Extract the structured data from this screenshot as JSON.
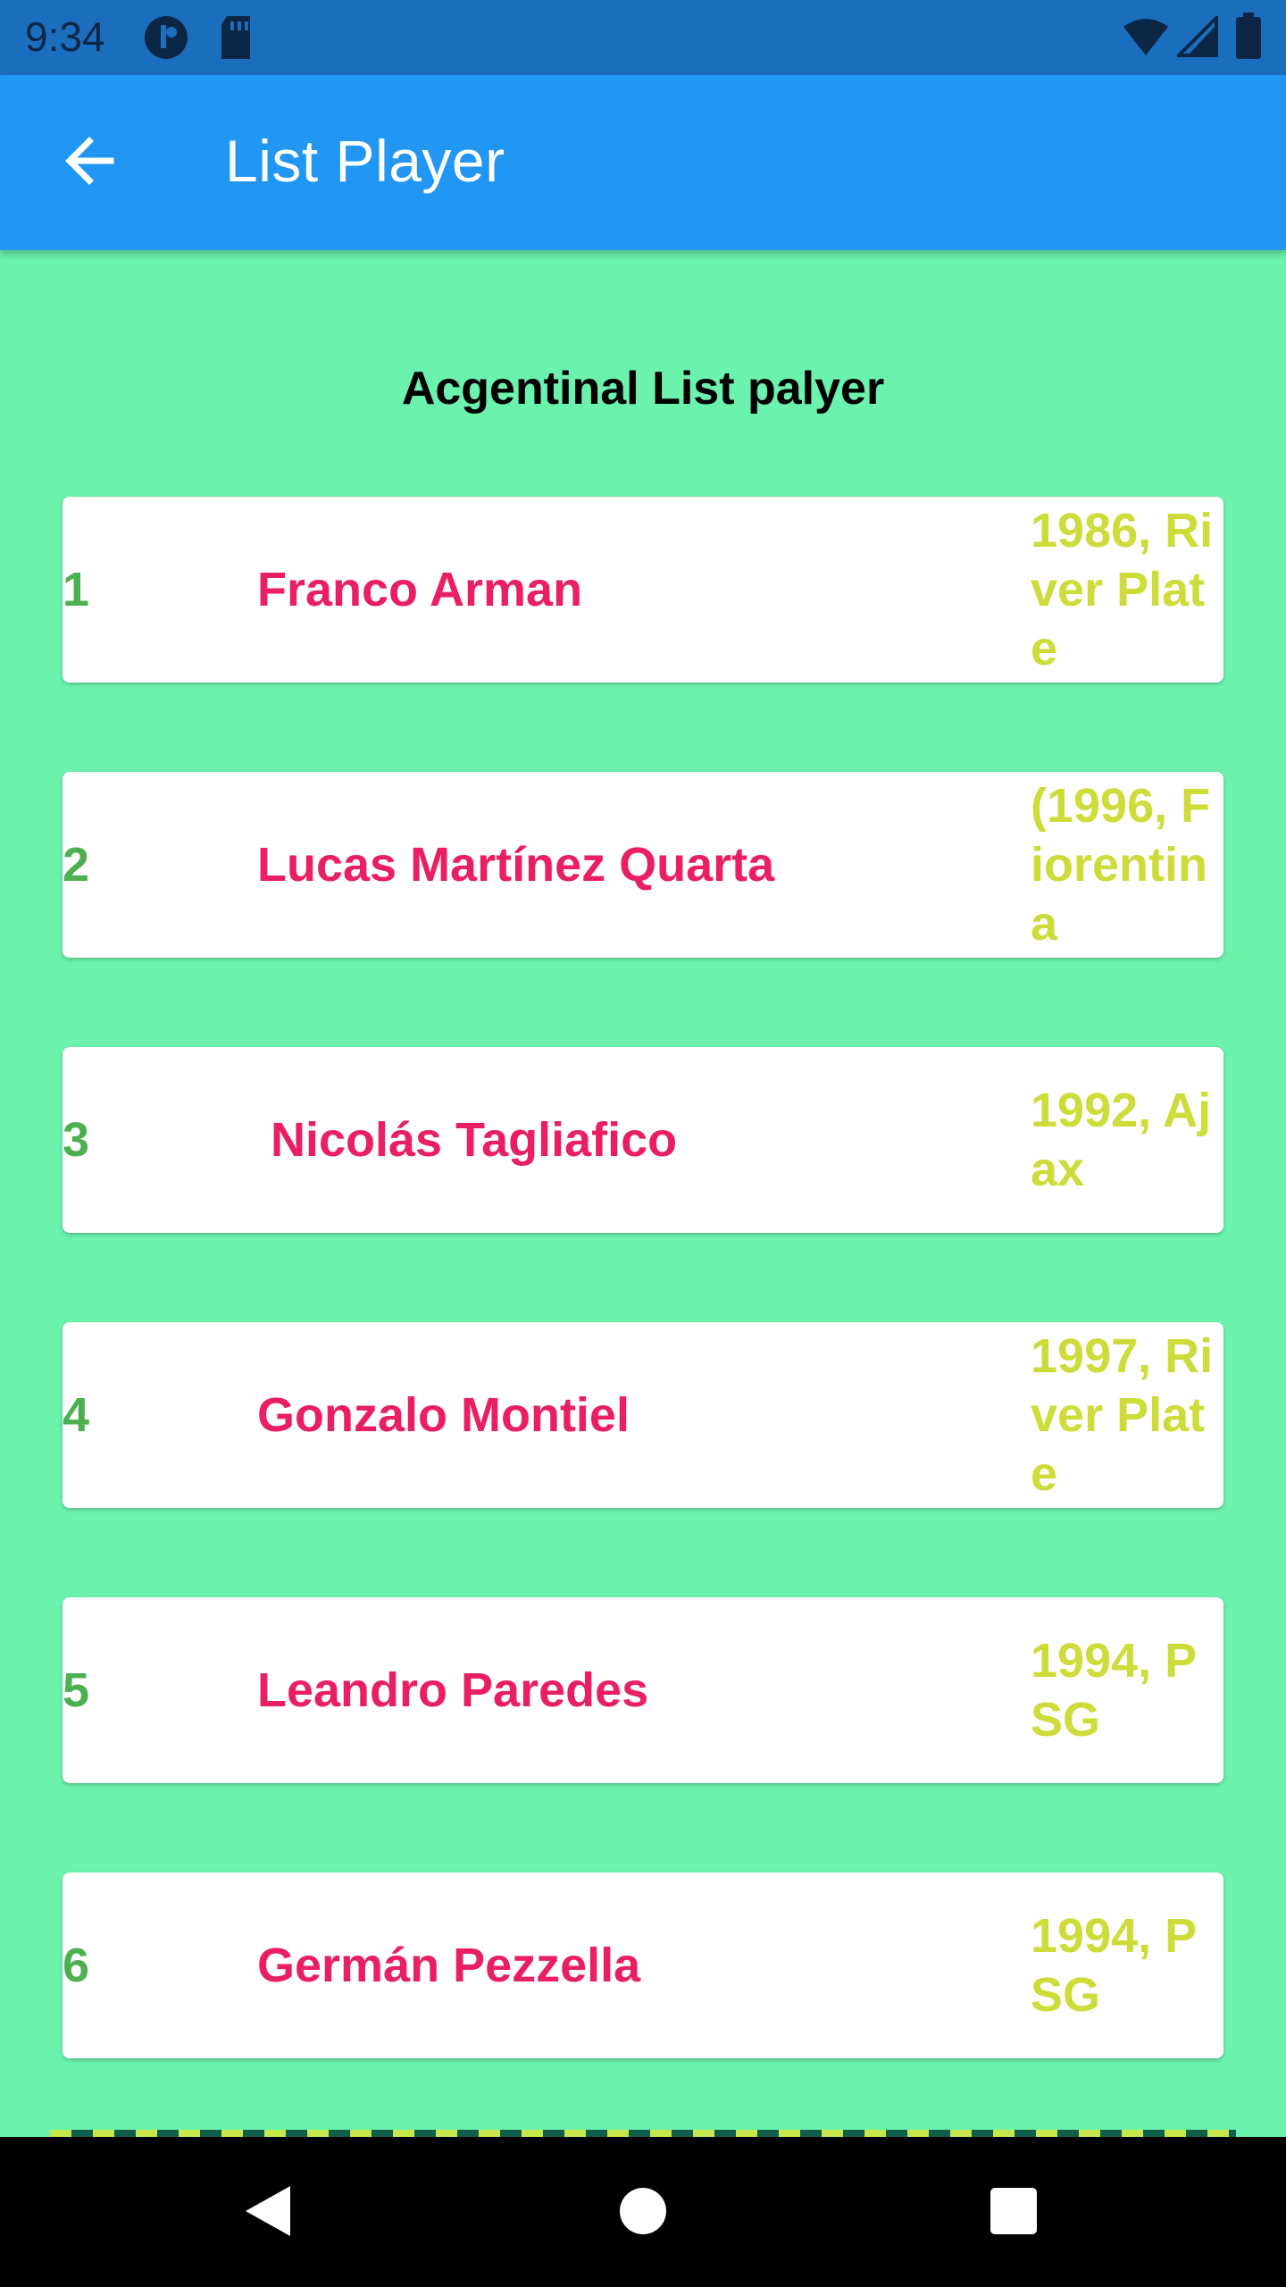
{
  "status_bar": {
    "time": "9:34",
    "icons": [
      "notification-icon",
      "sd-card-icon",
      "wifi-icon",
      "signal-icon",
      "battery-icon"
    ]
  },
  "app_bar": {
    "title": "List Player",
    "back_icon": "arrow-back-icon"
  },
  "heading": "Acgentinal List palyer",
  "players": [
    {
      "num": "1",
      "name": "Franco Arman",
      "info": "1986, River Plate"
    },
    {
      "num": "2",
      "name": "Lucas Martínez Quarta",
      "info": "(1996, Fiorentina"
    },
    {
      "num": "3",
      "name": " Nicolás Tagliafico",
      "info": "1992, Ajax"
    },
    {
      "num": "4",
      "name": "Gonzalo Montiel",
      "info": "1997, River Plate"
    },
    {
      "num": "5",
      "name": "Leandro Paredes",
      "info": "1994, PSG"
    },
    {
      "num": "6",
      "name": "Germán Pezzella",
      "info": "1994, PSG"
    }
  ],
  "colors": {
    "background": "#6BF2AD",
    "app_bar": "#2196F3",
    "number": "#4CAF50",
    "name": "#E91E63",
    "info": "#CDDC39"
  },
  "nav_bar": {
    "icons": [
      "back-triangle-icon",
      "home-circle-icon",
      "recents-square-icon"
    ]
  }
}
